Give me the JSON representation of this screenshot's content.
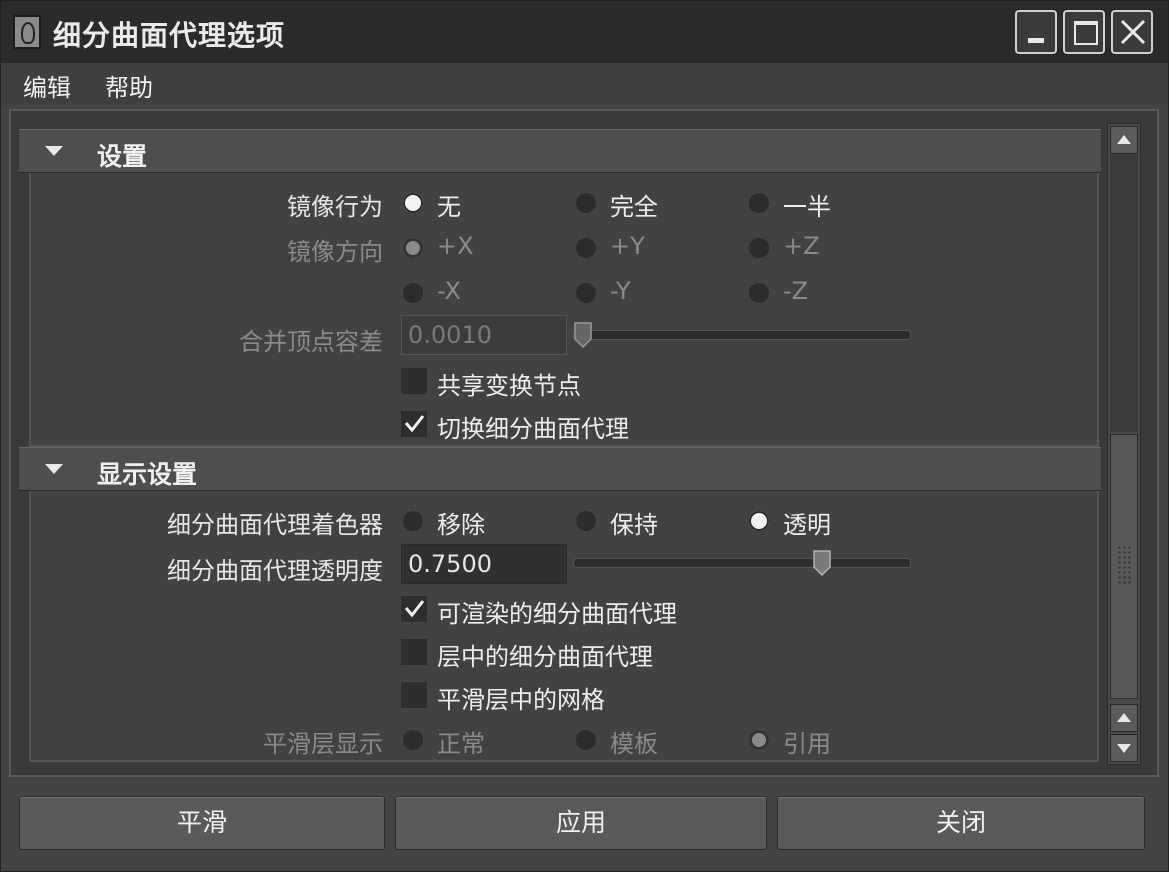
{
  "window": {
    "title": "细分曲面代理选项"
  },
  "menu": {
    "edit": "编辑",
    "help": "帮助"
  },
  "settings": {
    "header": "设置",
    "mirror_behavior": {
      "label": "镜像行为",
      "options": [
        "无",
        "完全",
        "一半"
      ],
      "selected": "无"
    },
    "mirror_direction": {
      "label": "镜像方向",
      "options_row1": [
        "+X",
        "+Y",
        "+Z"
      ],
      "options_row2": [
        "-X",
        "-Y",
        "-Z"
      ],
      "selected": "+X"
    },
    "merge_tolerance": {
      "label": "合并顶点容差",
      "value": "0.0010",
      "slider_fraction": 0.0
    },
    "share_transform": {
      "label": "共享变换节点",
      "checked": false
    },
    "toggle_proxy": {
      "label": "切换细分曲面代理",
      "checked": true
    }
  },
  "display": {
    "header": "显示设置",
    "shader": {
      "label": "细分曲面代理着色器",
      "options": [
        "移除",
        "保持",
        "透明"
      ],
      "selected": "透明"
    },
    "transparency": {
      "label": "细分曲面代理透明度",
      "value": "0.7500",
      "slider_fraction": 0.75
    },
    "renderable": {
      "label": "可渲染的细分曲面代理",
      "checked": true
    },
    "in_layer": {
      "label": "层中的细分曲面代理",
      "checked": false
    },
    "smooth_mesh_in_layer": {
      "label": "平滑层中的网格",
      "checked": false
    },
    "smooth_layer_display": {
      "label": "平滑层显示",
      "options": [
        "正常",
        "模板",
        "引用"
      ],
      "selected": "引用"
    }
  },
  "buttons": {
    "smooth": "平滑",
    "apply": "应用",
    "close": "关闭"
  }
}
